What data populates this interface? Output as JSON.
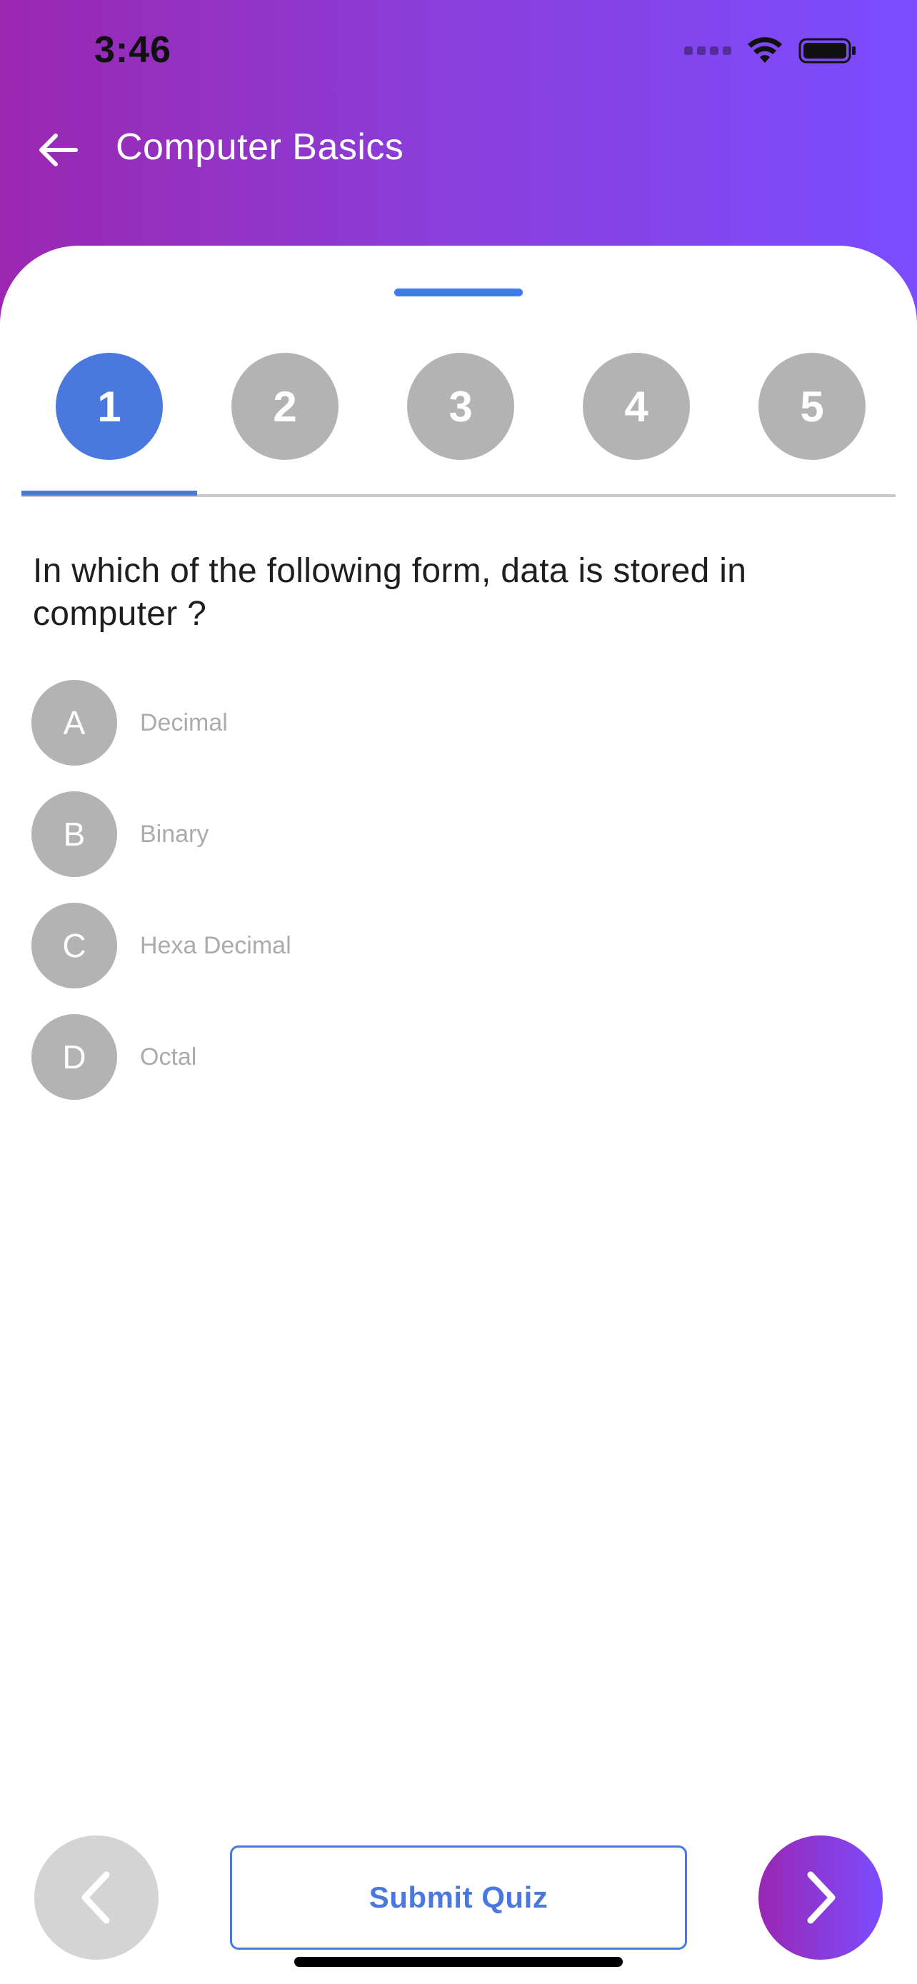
{
  "status_bar": {
    "time": "3:46"
  },
  "header": {
    "title": "Computer Basics"
  },
  "tabs": [
    {
      "label": "1",
      "active": true
    },
    {
      "label": "2",
      "active": false
    },
    {
      "label": "3",
      "active": false
    },
    {
      "label": "4",
      "active": false
    },
    {
      "label": "5",
      "active": false
    }
  ],
  "question": {
    "text": "In which of the following form, data is stored in computer ?"
  },
  "options": [
    {
      "letter": "A",
      "text": "Decimal"
    },
    {
      "letter": "B",
      "text": "Binary"
    },
    {
      "letter": "C",
      "text": "Hexa Decimal"
    },
    {
      "letter": "D",
      "text": "Octal"
    }
  ],
  "footer": {
    "submit_label": "Submit Quiz"
  },
  "colors": {
    "gradient_start": "#9b27b0",
    "gradient_end": "#7b4cff",
    "accent_blue": "#4a78df",
    "inactive_gray": "#b3b3b3",
    "option_text_gray": "#ababab"
  },
  "icons": {
    "back": "arrow-left-icon",
    "prev": "chevron-left-icon",
    "next": "chevron-right-icon",
    "wifi": "wifi-icon",
    "battery": "battery-icon",
    "signal": "signal-icon"
  }
}
